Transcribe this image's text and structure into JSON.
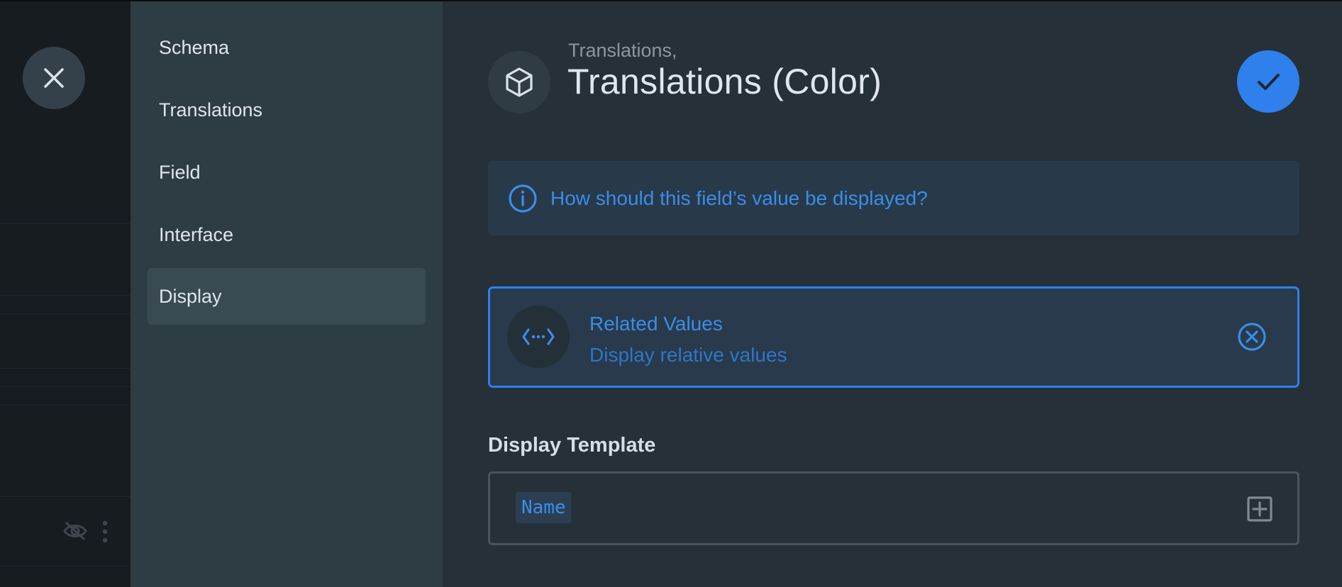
{
  "nav": {
    "items": [
      {
        "label": "Schema"
      },
      {
        "label": "Translations"
      },
      {
        "label": "Field"
      },
      {
        "label": "Interface"
      },
      {
        "label": "Display"
      }
    ],
    "active": "Display"
  },
  "header": {
    "breadcrumb": "Translations,",
    "title": "Translations (Color)",
    "icon": "cube-icon"
  },
  "notice": {
    "text": "How should this field’s value be displayed?",
    "icon": "info-icon"
  },
  "display": {
    "name": "Related Values",
    "description": "Display relative values",
    "icon": "related-values-icon"
  },
  "template": {
    "label": "Display Template",
    "chip": "Name"
  },
  "colors": {
    "accent": "#2f80ed",
    "background": "#263038",
    "nav_background": "#2e3c44"
  }
}
